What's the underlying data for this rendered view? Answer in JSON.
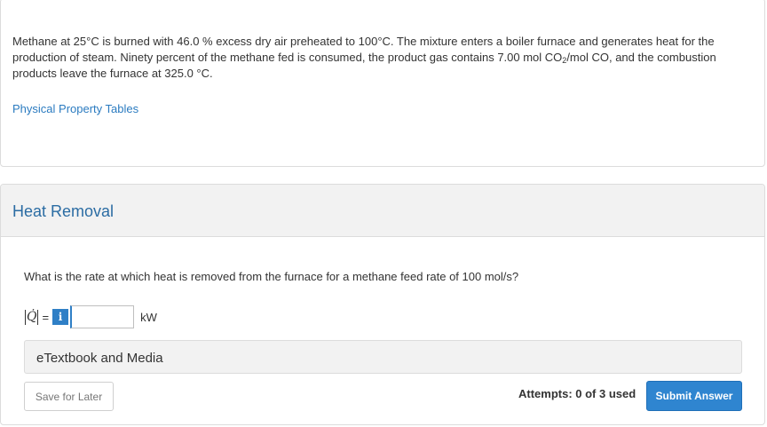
{
  "problem": {
    "text_part1": "Methane at 25°C is burned with 46.0 % excess dry air preheated to 100°C. The mixture enters a boiler furnace and generates heat for the production of steam. Ninety percent of the methane fed is consumed, the product gas contains 7.00 mol CO",
    "text_sub": "2",
    "text_part2": "/mol CO, and the combustion products leave the furnace at 325.0 °C.",
    "link_label": "Physical Property Tables"
  },
  "part": {
    "title": "Heat Removal",
    "question": "What is the rate at which heat is removed from the furnace for a methane feed rate of 100 mol/s?",
    "variable": "Q̇",
    "equals": "=",
    "info_icon": "i",
    "answer_value": "",
    "unit": "kW",
    "etextbook_label": "eTextbook and Media",
    "save_label": "Save for Later",
    "attempts_text": "Attempts: 0 of 3 used",
    "submit_label": "Submit Answer"
  },
  "colors": {
    "accent": "#2f85d0",
    "link": "#2b7bc0",
    "title": "#2b6ca3"
  }
}
